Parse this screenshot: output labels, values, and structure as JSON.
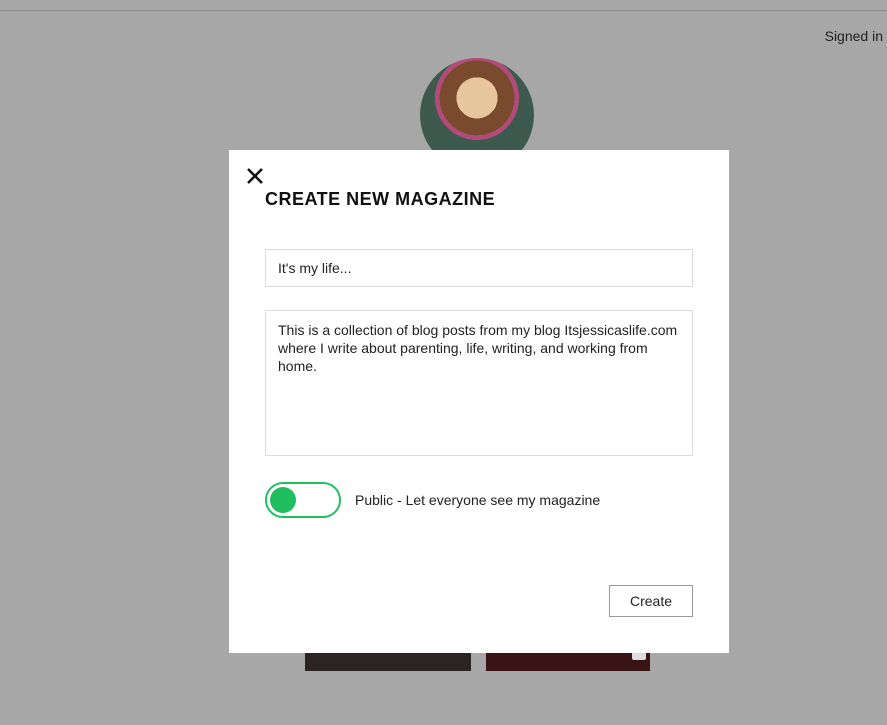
{
  "header": {
    "signed_in_text": "Signed in"
  },
  "modal": {
    "title": "CREATE NEW MAGAZINE",
    "title_input_value": "It's my life...",
    "description_value": "This is a collection of blog posts from my blog Itsjessicaslife.com where I write about parenting, life, writing, and working from home.",
    "toggle_label": "Public - Let everyone see my magazine",
    "toggle_on": true,
    "create_button_label": "Create"
  },
  "icons": {
    "close": "close-icon"
  }
}
